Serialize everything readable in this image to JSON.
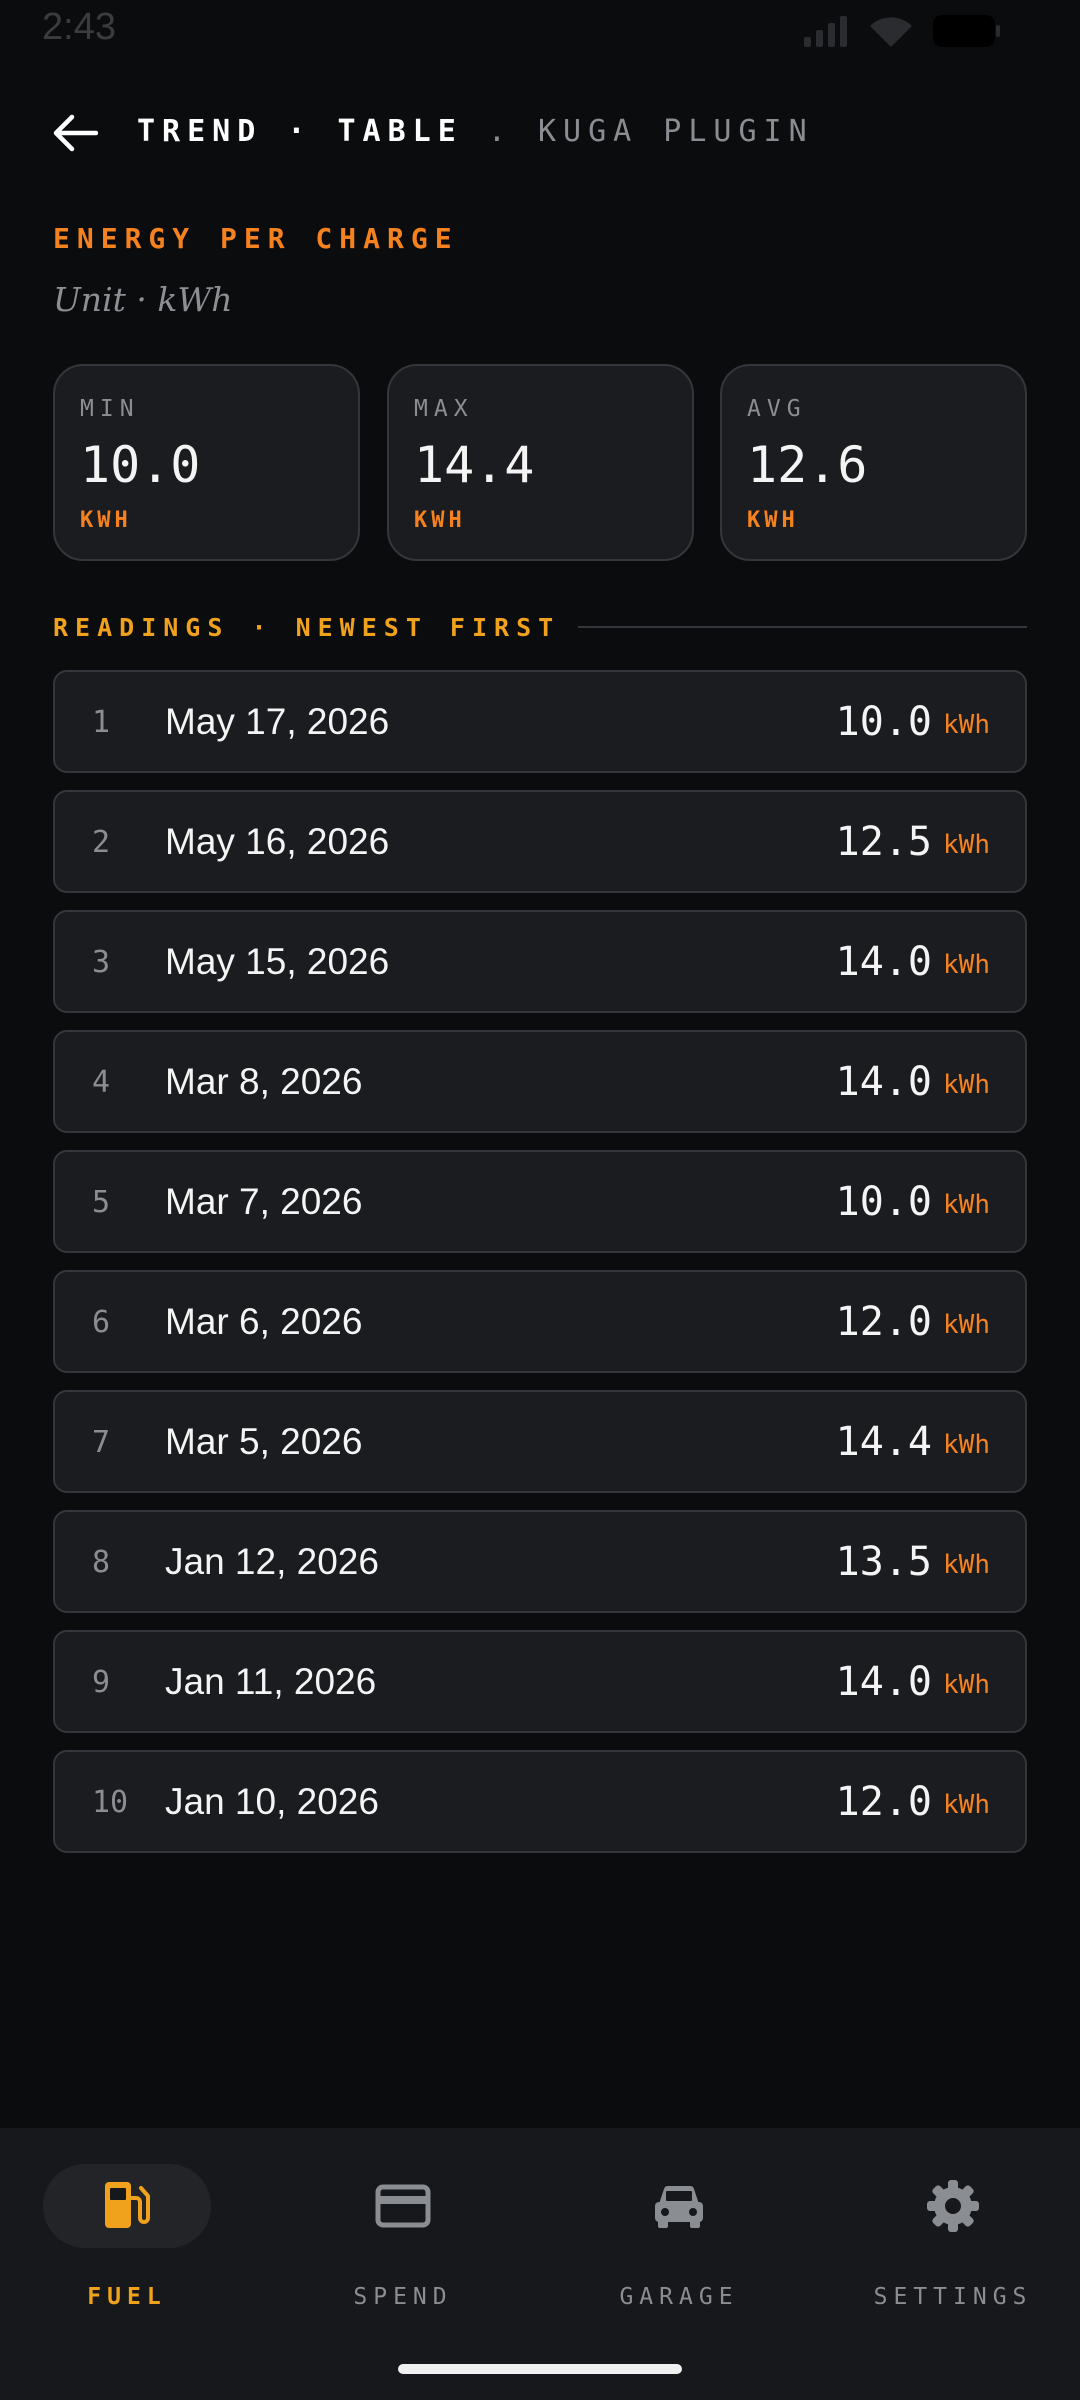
{
  "status": {
    "time": "2:43"
  },
  "header": {
    "crumb_1": "TREND",
    "sep_1": "·",
    "crumb_2": "TABLE",
    "sep_2": ".",
    "crumb_3": "KUGA PLUGIN"
  },
  "section": {
    "title": "ENERGY PER CHARGE",
    "unit_line": "Unit · kWh"
  },
  "stats": [
    {
      "label": "MIN",
      "value": "10.0",
      "unit": "KWH"
    },
    {
      "label": "MAX",
      "value": "14.4",
      "unit": "KWH"
    },
    {
      "label": "AVG",
      "value": "12.6",
      "unit": "KWH"
    }
  ],
  "readings": {
    "title": "READINGS · NEWEST FIRST",
    "rows": [
      {
        "idx": "1",
        "date": "May 17, 2026",
        "value": "10.0",
        "unit": "kWh"
      },
      {
        "idx": "2",
        "date": "May 16, 2026",
        "value": "12.5",
        "unit": "kWh"
      },
      {
        "idx": "3",
        "date": "May 15, 2026",
        "value": "14.0",
        "unit": "kWh"
      },
      {
        "idx": "4",
        "date": "Mar 8, 2026",
        "value": "14.0",
        "unit": "kWh"
      },
      {
        "idx": "5",
        "date": "Mar 7, 2026",
        "value": "10.0",
        "unit": "kWh"
      },
      {
        "idx": "6",
        "date": "Mar 6, 2026",
        "value": "12.0",
        "unit": "kWh"
      },
      {
        "idx": "7",
        "date": "Mar 5, 2026",
        "value": "14.4",
        "unit": "kWh"
      },
      {
        "idx": "8",
        "date": "Jan 12, 2026",
        "value": "13.5",
        "unit": "kWh"
      },
      {
        "idx": "9",
        "date": "Jan 11, 2026",
        "value": "14.0",
        "unit": "kWh"
      },
      {
        "idx": "10",
        "date": "Jan 10, 2026",
        "value": "12.0",
        "unit": "kWh"
      }
    ]
  },
  "nav": {
    "items": [
      {
        "label": "FUEL",
        "icon": "fuel-pump-icon"
      },
      {
        "label": "SPEND",
        "icon": "credit-card-icon"
      },
      {
        "label": "GARAGE",
        "icon": "car-icon"
      },
      {
        "label": "SETTINGS",
        "icon": "gear-icon"
      }
    ],
    "active": "FUEL"
  },
  "colors": {
    "accent": "#f5821f",
    "accent_yellow": "#f1a21c",
    "background": "#0b0c0e",
    "card": "#1b1c20"
  }
}
